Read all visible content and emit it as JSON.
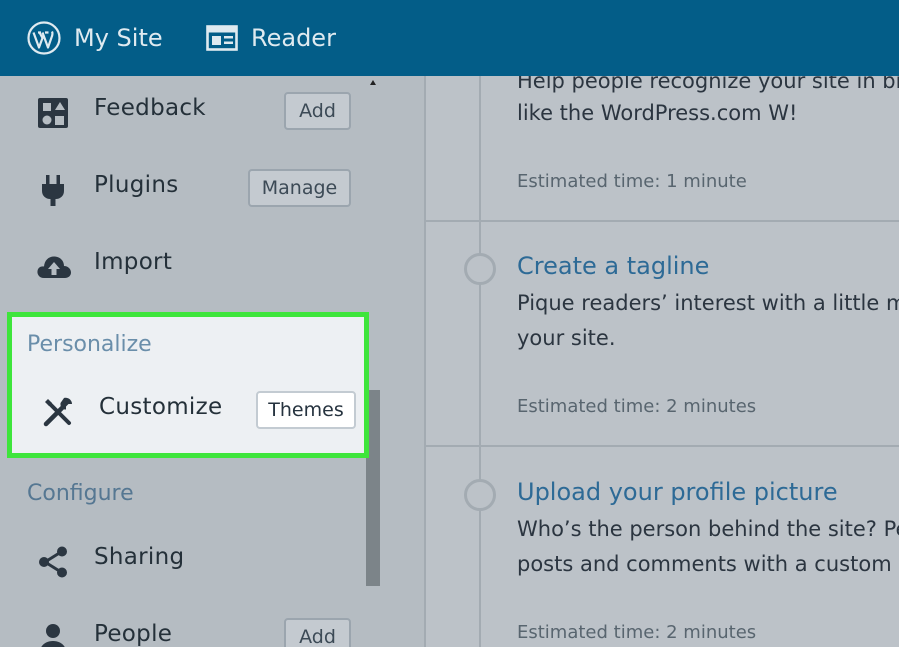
{
  "topbar": {
    "mysite_label": "My Site",
    "reader_label": "Reader",
    "mysite_icon": "wordpress-logo-icon",
    "reader_icon": "reader-icon",
    "background": "#035d88"
  },
  "sidebar": {
    "items": [
      {
        "label": "Feedback",
        "icon": "feedback-icon",
        "button": "Add"
      },
      {
        "label": "Plugins",
        "icon": "plugin-icon",
        "button": "Manage"
      },
      {
        "label": "Import",
        "icon": "cloud-upload-icon"
      }
    ],
    "personalize": {
      "header": "Personalize",
      "item": {
        "label": "Customize",
        "icon": "tools-icon",
        "button": "Themes"
      }
    },
    "configure": {
      "header": "Configure",
      "items": [
        {
          "label": "Sharing",
          "icon": "share-icon"
        },
        {
          "label": "People",
          "icon": "person-icon",
          "button": "Add"
        }
      ]
    },
    "highlight_color": "#3ee53b"
  },
  "main": {
    "tasks": [
      {
        "title": "",
        "desc_line1": "Help people recognize your site in bro",
        "desc_line2": "like the WordPress.com W!",
        "time": "Estimated time: 1 minute"
      },
      {
        "title": "Create a tagline",
        "desc_line1": "Pique readers’ interest with a little mo",
        "desc_line2": "your site.",
        "time": "Estimated time: 2 minutes"
      },
      {
        "title": "Upload your profile picture",
        "desc_line1": "Who’s the person behind the site? Pe",
        "desc_line2": "posts and comments with a custom p",
        "time": "Estimated time: 2 minutes"
      }
    ]
  }
}
